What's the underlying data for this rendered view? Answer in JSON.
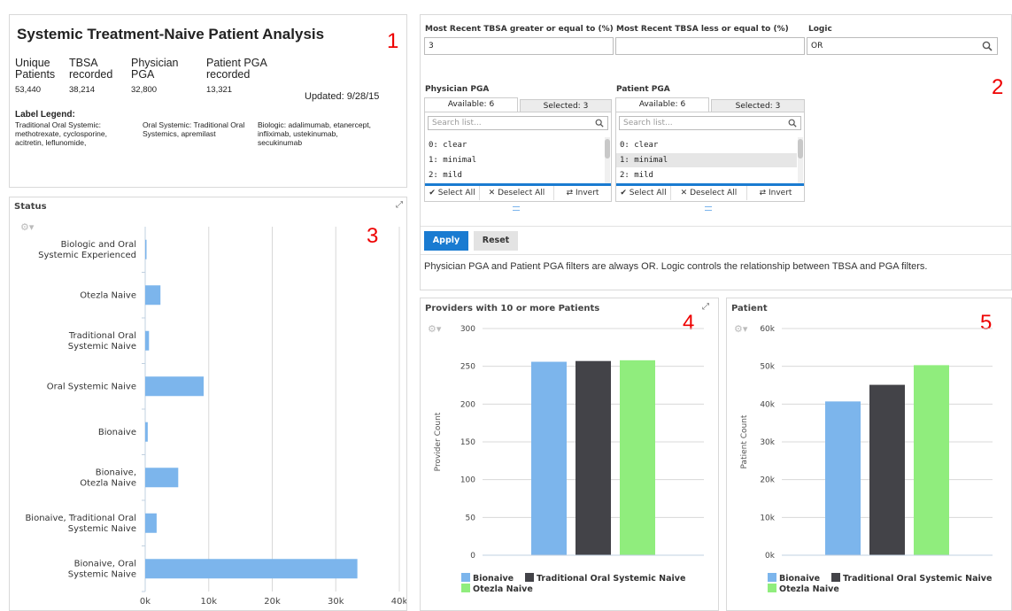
{
  "summary": {
    "title": "Systemic Treatment-Naive Patient Analysis",
    "number": "1",
    "kpis": [
      {
        "label": "Unique Patients",
        "value": "53,440"
      },
      {
        "label": "TBSA recorded",
        "value": "38,214"
      },
      {
        "label": "Physician PGA",
        "value": "32,800"
      },
      {
        "label": "Patient PGA recorded",
        "value": "13,321"
      }
    ],
    "updated": "Updated: 9/28/15",
    "legend_title": "Label Legend:",
    "legend_items": [
      "Traditional Oral Systemic: methotrexate, cyclosporine, acitretin, leflunomide,",
      "Oral Systemic: Traditional Oral Systemics, apremilast",
      "Biologic: adalimumab, etanercept, infliximab, ustekinumab, secukinumab"
    ]
  },
  "filters": {
    "number": "2",
    "tbsa_gte_label": "Most Recent TBSA greater or equal to (%)",
    "tbsa_gte_value": "3",
    "tbsa_lte_label": "Most Recent TBSA less or equal to (%)",
    "tbsa_lte_value": "",
    "logic_label": "Logic",
    "logic_value": "OR",
    "physician": {
      "label": "Physician PGA",
      "available": "Available: 6",
      "selected": "Selected: 3",
      "search_placeholder": "Search list...",
      "items": [
        "0: clear",
        "1: minimal",
        "2: mild"
      ]
    },
    "patient": {
      "label": "Patient PGA",
      "available": "Available: 6",
      "selected": "Selected: 3",
      "search_placeholder": "Search list...",
      "items": [
        "0: clear",
        "1: minimal",
        "2: mild"
      ]
    },
    "select_all": "Select All",
    "deselect_all": "Deselect All",
    "invert": "Invert",
    "apply": "Apply",
    "reset": "Reset",
    "note": "Physician PGA and Patient PGA filters are always OR. Logic controls the relationship between TBSA and PGA filters."
  },
  "colors": {
    "bionaive": "#7cb5ec",
    "traditional": "#434348",
    "otezla": "#90ed7d",
    "apply": "#1a7bd1",
    "number": "#e00000"
  },
  "status_panel": {
    "title": "Status",
    "number": "3"
  },
  "providers_panel": {
    "title": "Providers with 10 or more Patients",
    "number": "4"
  },
  "patient_panel": {
    "title": "Patient",
    "number": "5"
  },
  "chart_data": [
    {
      "type": "bar",
      "orientation": "horizontal",
      "title": "Status",
      "categories": [
        "Biologic and Oral Systemic Experienced",
        "Otezla Naive",
        "Traditional Oral Systemic Naive",
        "Oral Systemic Naive",
        "Bionaive",
        "Bionaive, Otezla Naive",
        "Bionaive, Traditional Oral Systemic Naive",
        "Bionaive, Oral Systemic Naive"
      ],
      "values": [
        150,
        2400,
        600,
        9200,
        400,
        5200,
        1800,
        33400
      ],
      "xlim": [
        0,
        40000
      ],
      "x_ticks": [
        "0k",
        "10k",
        "20k",
        "30k",
        "40k"
      ],
      "grid": true,
      "color": "#7cb5ec"
    },
    {
      "type": "bar",
      "title": "Providers with 10 or more Patients",
      "ylabel": "Provider Count",
      "ylim": [
        0,
        300
      ],
      "y_ticks": [
        "0",
        "50",
        "100",
        "150",
        "200",
        "250",
        "300"
      ],
      "series": [
        {
          "name": "Bionaive",
          "values": [
            256
          ],
          "color": "#7cb5ec"
        },
        {
          "name": "Traditional Oral Systemic Naive",
          "values": [
            257
          ],
          "color": "#434348"
        },
        {
          "name": "Otezla Naive",
          "values": [
            258
          ],
          "color": "#90ed7d"
        }
      ],
      "legend": "bottom"
    },
    {
      "type": "bar",
      "title": "Patient",
      "ylabel": "Patient Count",
      "ylim": [
        0,
        60000
      ],
      "y_ticks": [
        "0k",
        "10k",
        "20k",
        "30k",
        "40k",
        "50k",
        "60k"
      ],
      "series": [
        {
          "name": "Bionaive",
          "values": [
            40700
          ],
          "color": "#7cb5ec"
        },
        {
          "name": "Traditional Oral Systemic Naive",
          "values": [
            45100
          ],
          "color": "#434348"
        },
        {
          "name": "Otezla Naive",
          "values": [
            50300
          ],
          "color": "#90ed7d"
        }
      ],
      "legend": "bottom"
    }
  ]
}
